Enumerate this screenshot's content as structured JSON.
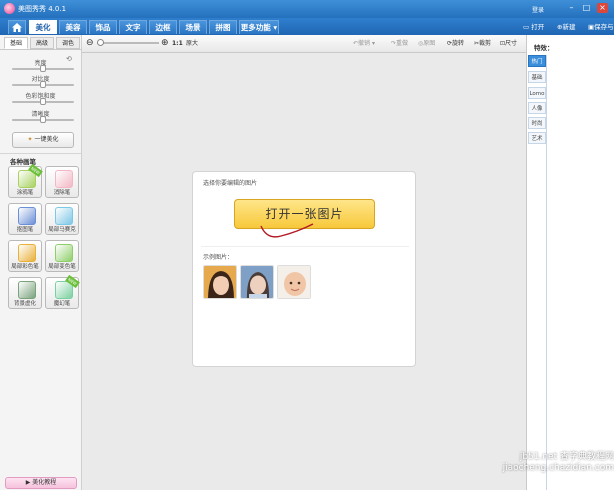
{
  "app": {
    "title": "美图秀秀 4.0.1",
    "login": "登录",
    "window_min": "–",
    "window_max": "□",
    "window_close": "×"
  },
  "tabs": [
    {
      "label": "美化",
      "active": true
    },
    {
      "label": "美容",
      "active": false
    },
    {
      "label": "饰品",
      "active": false
    },
    {
      "label": "文字",
      "active": false
    },
    {
      "label": "边框",
      "active": false
    },
    {
      "label": "场景",
      "active": false
    },
    {
      "label": "拼图",
      "active": false
    },
    {
      "label": "更多功能 ▾",
      "active": false
    }
  ],
  "top_actions": {
    "open": "打开",
    "new": "新建",
    "save": "保存与分享"
  },
  "toolbar": {
    "zoom_ratio": "1:1",
    "original_size": "原大",
    "undo": "撤销",
    "redo": "重做",
    "original": "原图",
    "rotate": "旋转",
    "crop": "裁剪",
    "resize": "尺寸"
  },
  "left_panel": {
    "subtabs": [
      {
        "label": "基础",
        "active": true
      },
      {
        "label": "高级",
        "active": false
      },
      {
        "label": "调色",
        "active": false
      }
    ],
    "sliders": [
      {
        "label": "亮度",
        "value": 0.5
      },
      {
        "label": "对比度",
        "value": 0.5
      },
      {
        "label": "色彩饱和度",
        "value": 0.5
      },
      {
        "label": "清晰度",
        "value": 0.5
      }
    ],
    "auto_beautify": "一键美化",
    "brush_title": "各种画笔",
    "brushes": [
      {
        "label": "涂鸦笔",
        "badge": "NEW",
        "color": "#a7d160"
      },
      {
        "label": "消除笔",
        "badge": "",
        "color": "#f2b8c5"
      },
      {
        "label": "抠图笔",
        "badge": "",
        "color": "#6b8fd6"
      },
      {
        "label": "局部马赛克",
        "badge": "",
        "color": "#7ec7e6"
      },
      {
        "label": "局部彩色笔",
        "badge": "",
        "color": "#e9b03a"
      },
      {
        "label": "局部变色笔",
        "badge": "",
        "color": "#8fcf6a"
      },
      {
        "label": "背景虚化",
        "badge": "",
        "color": "#7aa37d"
      },
      {
        "label": "魔幻笔",
        "badge": "NEW",
        "color": "#7cd0a0"
      }
    ],
    "tutorial": "美化教程"
  },
  "card": {
    "prompt": "选择你要编辑的图片",
    "open_button": "打开一张图片",
    "samples_label": "示例图片："
  },
  "right_panel": {
    "title": "特效：",
    "tabs": [
      {
        "label": "热门",
        "active": true
      },
      {
        "label": "基础",
        "active": false
      },
      {
        "label": "Lomo",
        "active": false
      },
      {
        "label": "人像",
        "active": false
      },
      {
        "label": "时尚",
        "active": false
      },
      {
        "label": "艺术",
        "active": false
      }
    ]
  },
  "watermark": "jb51.net 查字典教程网 jiaocheng.chazidian.com"
}
